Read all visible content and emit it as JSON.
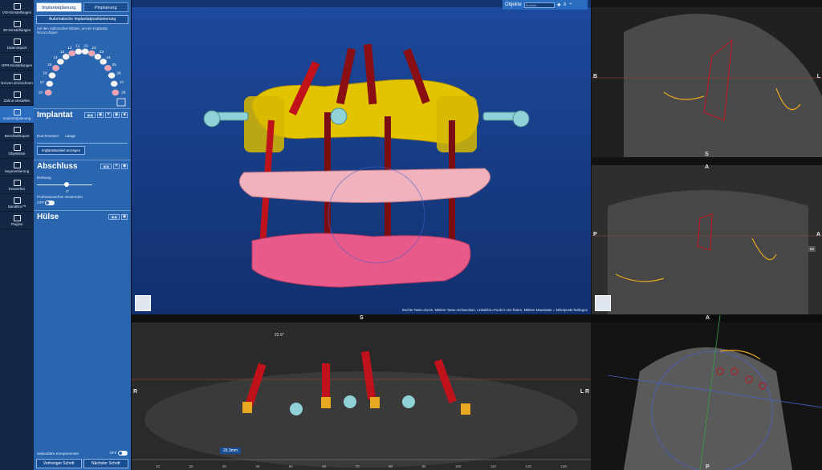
{
  "toolbar": {
    "items": [
      {
        "label": "VOI-Einstellungen",
        "icon": "cube-icon"
      },
      {
        "label": "3D-Einstellungen",
        "icon": "settings-3d-icon"
      },
      {
        "label": "Datenimport",
        "icon": "import-icon"
      },
      {
        "label": "OPR-Einstellungen",
        "icon": "opr-icon"
      },
      {
        "label": "Nerven einzeichnen",
        "icon": "nerve-icon"
      },
      {
        "label": "Zähne einstellen",
        "icon": "tooth-icon"
      },
      {
        "label": "Implantatplanung",
        "icon": "implant-icon"
      },
      {
        "label": "Berichte/Export",
        "icon": "report-icon"
      },
      {
        "label": "Objektliste",
        "icon": "list-icon"
      },
      {
        "label": "Segmentierung",
        "icon": "segment-icon"
      },
      {
        "label": "Entwerfen",
        "icon": "design-icon"
      },
      {
        "label": "SandBox™",
        "icon": "sandbox-icon"
      },
      {
        "label": "Plugins",
        "icon": "plugins-icon"
      }
    ],
    "active_index": 6
  },
  "panel": {
    "tabs": [
      "Implantatplanung",
      "Pinplanung"
    ],
    "auto_button": "Automatische Implantatpositionierung",
    "hint": "Auf den Zahnmarker klicken, um ein Implantat hinzuzufügen",
    "teeth_upper": [
      "18",
      "17",
      "16",
      "15",
      "14",
      "13",
      "12",
      "11",
      "21",
      "22",
      "23",
      "24",
      "25",
      "26",
      "27",
      "28"
    ],
    "implantat": {
      "title": "Implantat",
      "diameter_label": "Durchmesser",
      "length_label": "Länge",
      "angle_button": "Implantatwinkel anzeigen"
    },
    "abschluss": {
      "title": "Abschluss",
      "rotation_label": "Drehung",
      "rotation_value": "0°",
      "axis_label": "Prothesenachse verwenden",
      "axis_toggle": "OFF"
    },
    "huelse": {
      "title": "Hülse"
    },
    "secondary": {
      "label": "Sekundäre Komponenten",
      "toggle": "OFF"
    },
    "nav": {
      "prev": "Vorheriger Schritt",
      "next": "Nächster Schritt"
    }
  },
  "view3d": {
    "objekte_label": "Objekte",
    "search_placeholder": "Suchen",
    "status": "Rechte Taste=Zoom, Mittlere Taste=Schwenken, Linksklick=Punkt in 2D finden, Mittlere Maustaste = Mittelpunkt festlegen"
  },
  "panoramic": {
    "orient_top": "S",
    "orient_left": "R",
    "orient_right": "L R",
    "angle": "22.9°",
    "measure": "26.3mm",
    "ruler": [
      "10",
      "20",
      "30",
      "40",
      "50",
      "60",
      "70",
      "80",
      "90",
      "100",
      "110",
      "120",
      "130"
    ]
  },
  "sagittal1": {
    "left": "B",
    "right": "L",
    "bottom": "S"
  },
  "sagittal2": {
    "top": "A",
    "left": "P",
    "right": "A",
    "badge": "60"
  },
  "axial": {
    "top": "A",
    "bottom": "P"
  },
  "colors": {
    "panel": "#2a65b0",
    "active_tool": "#2a6cc0",
    "implant_red": "#c0121a",
    "guide_yellow": "#e0c000",
    "gum_pink": "#e85a8a"
  }
}
